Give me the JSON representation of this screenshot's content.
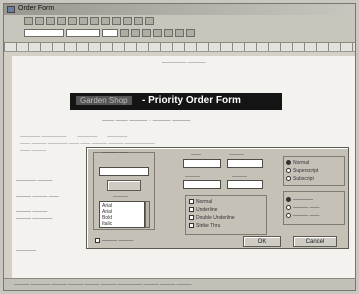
{
  "window": {
    "title": "Order Form"
  },
  "document": {
    "banner_left": "Garden Shop",
    "banner_right": "- Priority Order Form"
  },
  "dialog": {
    "ok_label": "OK",
    "cancel_label": "Cancel",
    "radio_top_1": "Normal",
    "radio_top_2": "Superscript",
    "radio_top_3": "Subscript",
    "radio_mid_1": "Normal",
    "style_opt_2": "Underline",
    "style_opt_3": "Double Underline",
    "style_opt_4": "Strike Thru",
    "fonts_list": [
      "Arial",
      "Arial",
      "Bold",
      "Italic"
    ]
  }
}
